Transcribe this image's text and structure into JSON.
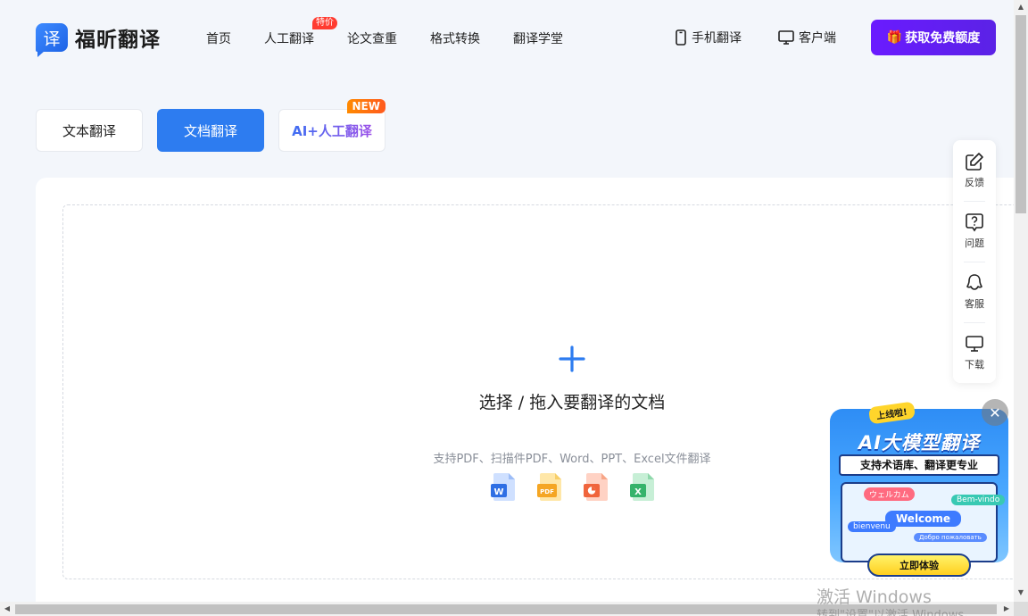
{
  "header": {
    "logo_mark": "译",
    "logo_text": "福昕翻译",
    "nav": [
      {
        "label": "首页"
      },
      {
        "label": "人工翻译",
        "badge": "特价"
      },
      {
        "label": "论文查重"
      },
      {
        "label": "格式转换"
      },
      {
        "label": "翻译学堂"
      }
    ],
    "mobile_label": "手机翻译",
    "client_label": "客户端",
    "free_button_label": "获取免费额度"
  },
  "tabs": {
    "text": "文本翻译",
    "document": "文档翻译",
    "ai_human": "AI+人工翻译",
    "ai_badge": "NEW",
    "active": "document"
  },
  "upload": {
    "title": "选择 / 拖入要翻译的文档",
    "subtitle": "支持PDF、扫描件PDF、Word、PPT、Excel文件翻译",
    "file_types": [
      {
        "label": "W",
        "icon": "word-icon",
        "color": "#2f6fe4"
      },
      {
        "label": "PDF",
        "icon": "pdf-icon",
        "color": "#f5a623"
      },
      {
        "label": "P",
        "icon": "ppt-icon",
        "color": "#f0643c"
      },
      {
        "label": "X",
        "icon": "excel-icon",
        "color": "#36b36b"
      }
    ]
  },
  "sidebar": {
    "items": [
      {
        "label": "反馈",
        "icon": "edit-icon"
      },
      {
        "label": "问题",
        "icon": "question-icon"
      },
      {
        "label": "客服",
        "icon": "headset-icon"
      },
      {
        "label": "下载",
        "icon": "monitor-icon"
      }
    ]
  },
  "promo": {
    "badge": "上线啦!",
    "title": "AI大模型翻译",
    "subtitle": "支持术语库、翻译更专业",
    "bubbles": [
      "ウェルカム",
      "Bem-vindo",
      "Welcome",
      "bienvenu",
      "Добро пожаловать"
    ],
    "cta": "立即体验",
    "close": "✕"
  },
  "watermark": {
    "line1": "激活 Windows",
    "line2": "转到\"设置\"以激活 Windows。"
  },
  "colors": {
    "primary": "#2d7cf0",
    "accent_purple": "#6a1bff",
    "badge_red": "#ff3b30",
    "badge_orange": "#ff8a00"
  }
}
